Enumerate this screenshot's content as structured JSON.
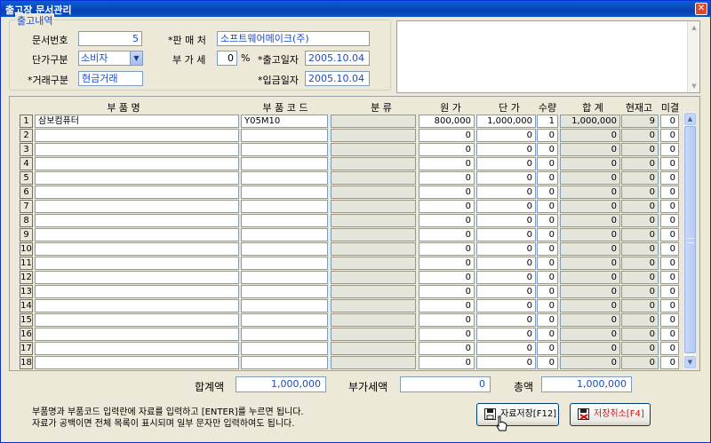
{
  "window": {
    "title": "출고장 문서관리",
    "close_glyph": "✕"
  },
  "header": {
    "group_title": "출고내역",
    "doc_no_label": "문서번호",
    "doc_no_value": "5",
    "price_type_label": "단가구분",
    "price_type_value": "소비자",
    "deal_type_label": "*거래구분",
    "deal_type_value": "현금거래",
    "seller_label": "*판 매 처",
    "seller_value": "소프트웨어메이크(주)",
    "vat_label": "부 가 세",
    "vat_value": "0",
    "vat_unit": "%",
    "ship_date_label": "*출고일자",
    "ship_date_value": "2005.10.04",
    "pay_date_label": "*입금일자",
    "pay_date_value": "2005.10.04"
  },
  "table": {
    "columns": [
      "부 품 명",
      "부 품 코 드",
      "분 류",
      "원 가",
      "단 가",
      "수량",
      "합 계",
      "현재고",
      "미결"
    ],
    "rows": [
      {
        "no": "1",
        "name": "삼보컴퓨터",
        "code": "Y05M10",
        "category": "",
        "cost": "800,000",
        "price": "1,000,000",
        "qty": "1",
        "total": "1,000,000",
        "stock": "9",
        "pending": "0"
      },
      {
        "no": "2",
        "name": "",
        "code": "",
        "category": "",
        "cost": "0",
        "price": "0",
        "qty": "0",
        "total": "0",
        "stock": "0",
        "pending": "0"
      },
      {
        "no": "3",
        "name": "",
        "code": "",
        "category": "",
        "cost": "0",
        "price": "0",
        "qty": "0",
        "total": "0",
        "stock": "0",
        "pending": "0"
      },
      {
        "no": "4",
        "name": "",
        "code": "",
        "category": "",
        "cost": "0",
        "price": "0",
        "qty": "0",
        "total": "0",
        "stock": "0",
        "pending": "0"
      },
      {
        "no": "5",
        "name": "",
        "code": "",
        "category": "",
        "cost": "0",
        "price": "0",
        "qty": "0",
        "total": "0",
        "stock": "0",
        "pending": "0"
      },
      {
        "no": "6",
        "name": "",
        "code": "",
        "category": "",
        "cost": "0",
        "price": "0",
        "qty": "0",
        "total": "0",
        "stock": "0",
        "pending": "0"
      },
      {
        "no": "7",
        "name": "",
        "code": "",
        "category": "",
        "cost": "0",
        "price": "0",
        "qty": "0",
        "total": "0",
        "stock": "0",
        "pending": "0"
      },
      {
        "no": "8",
        "name": "",
        "code": "",
        "category": "",
        "cost": "0",
        "price": "0",
        "qty": "0",
        "total": "0",
        "stock": "0",
        "pending": "0"
      },
      {
        "no": "9",
        "name": "",
        "code": "",
        "category": "",
        "cost": "0",
        "price": "0",
        "qty": "0",
        "total": "0",
        "stock": "0",
        "pending": "0"
      },
      {
        "no": "10",
        "name": "",
        "code": "",
        "category": "",
        "cost": "0",
        "price": "0",
        "qty": "0",
        "total": "0",
        "stock": "0",
        "pending": "0"
      },
      {
        "no": "11",
        "name": "",
        "code": "",
        "category": "",
        "cost": "0",
        "price": "0",
        "qty": "0",
        "total": "0",
        "stock": "0",
        "pending": "0"
      },
      {
        "no": "12",
        "name": "",
        "code": "",
        "category": "",
        "cost": "0",
        "price": "0",
        "qty": "0",
        "total": "0",
        "stock": "0",
        "pending": "0"
      },
      {
        "no": "13",
        "name": "",
        "code": "",
        "category": "",
        "cost": "0",
        "price": "0",
        "qty": "0",
        "total": "0",
        "stock": "0",
        "pending": "0"
      },
      {
        "no": "14",
        "name": "",
        "code": "",
        "category": "",
        "cost": "0",
        "price": "0",
        "qty": "0",
        "total": "0",
        "stock": "0",
        "pending": "0"
      },
      {
        "no": "15",
        "name": "",
        "code": "",
        "category": "",
        "cost": "0",
        "price": "0",
        "qty": "0",
        "total": "0",
        "stock": "0",
        "pending": "0"
      },
      {
        "no": "16",
        "name": "",
        "code": "",
        "category": "",
        "cost": "0",
        "price": "0",
        "qty": "0",
        "total": "0",
        "stock": "0",
        "pending": "0"
      },
      {
        "no": "17",
        "name": "",
        "code": "",
        "category": "",
        "cost": "0",
        "price": "0",
        "qty": "0",
        "total": "0",
        "stock": "0",
        "pending": "0"
      },
      {
        "no": "18",
        "name": "",
        "code": "",
        "category": "",
        "cost": "0",
        "price": "0",
        "qty": "0",
        "total": "0",
        "stock": "0",
        "pending": "0"
      }
    ]
  },
  "totals": {
    "sum_label": "합계액",
    "sum_value": "1,000,000",
    "vat_label": "부가세액",
    "vat_value": "0",
    "grand_label": "총액",
    "grand_value": "1,000,000"
  },
  "help": {
    "line1": "부품명과 부품코드 입력란에 자료를 입력하고 [ENTER]를 누르면 됩니다.",
    "line2": "자료가 공백이면 전체 목록이 표시되며 일부 문자만 입력하여도 됩니다."
  },
  "buttons": {
    "save_label": "자료저장[F12]",
    "cancel_label": "저장취소[F4]"
  },
  "colors": {
    "accent_blue": "#1a4bc5",
    "title_bar": "#0841b0",
    "cancel_text": "#d01010"
  }
}
